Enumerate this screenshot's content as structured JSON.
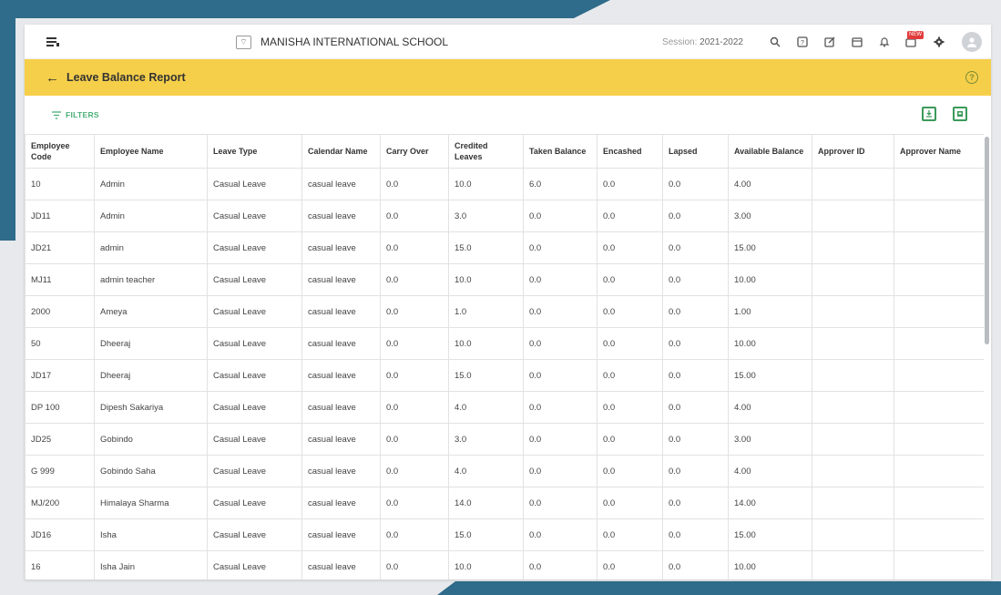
{
  "header": {
    "school_name": "MANISHA INTERNATIONAL SCHOOL",
    "session_label": "Session:",
    "session_value": "2021-2022",
    "badge": "NEW"
  },
  "page": {
    "title": "Leave Balance Report",
    "filters_label": "FILTERS"
  },
  "table": {
    "columns": [
      "Employee Code",
      "Employee Name",
      "Leave Type",
      "Calendar Name",
      "Carry Over",
      "Credited Leaves",
      "Taken Balance",
      "Encashed",
      "Lapsed",
      "Available Balance",
      "Approver ID",
      "Approver Name"
    ],
    "rows": [
      [
        "10",
        "Admin",
        "Casual Leave",
        "casual leave",
        "0.0",
        "10.0",
        "6.0",
        "0.0",
        "0.0",
        "4.00",
        "",
        ""
      ],
      [
        "JD11",
        "Admin",
        "Casual Leave",
        "casual leave",
        "0.0",
        "3.0",
        "0.0",
        "0.0",
        "0.0",
        "3.00",
        "",
        ""
      ],
      [
        "JD21",
        "admin",
        "Casual Leave",
        "casual leave",
        "0.0",
        "15.0",
        "0.0",
        "0.0",
        "0.0",
        "15.00",
        "",
        ""
      ],
      [
        "MJ11",
        "admin teacher",
        "Casual Leave",
        "casual leave",
        "0.0",
        "10.0",
        "0.0",
        "0.0",
        "0.0",
        "10.00",
        "",
        ""
      ],
      [
        "2000",
        "Ameya",
        "Casual Leave",
        "casual leave",
        "0.0",
        "1.0",
        "0.0",
        "0.0",
        "0.0",
        "1.00",
        "",
        ""
      ],
      [
        "50",
        "Dheeraj",
        "Casual Leave",
        "casual leave",
        "0.0",
        "10.0",
        "0.0",
        "0.0",
        "0.0",
        "10.00",
        "",
        ""
      ],
      [
        "JD17",
        "Dheeraj",
        "Casual Leave",
        "casual leave",
        "0.0",
        "15.0",
        "0.0",
        "0.0",
        "0.0",
        "15.00",
        "",
        ""
      ],
      [
        "DP 100",
        "Dipesh Sakariya",
        "Casual Leave",
        "casual leave",
        "0.0",
        "4.0",
        "0.0",
        "0.0",
        "0.0",
        "4.00",
        "",
        ""
      ],
      [
        "JD25",
        "Gobindo",
        "Casual Leave",
        "casual leave",
        "0.0",
        "3.0",
        "0.0",
        "0.0",
        "0.0",
        "3.00",
        "",
        ""
      ],
      [
        "G 999",
        "Gobindo Saha",
        "Casual Leave",
        "casual leave",
        "0.0",
        "4.0",
        "0.0",
        "0.0",
        "0.0",
        "4.00",
        "",
        ""
      ],
      [
        "MJ/200",
        "Himalaya Sharma",
        "Casual Leave",
        "casual leave",
        "0.0",
        "14.0",
        "0.0",
        "0.0",
        "0.0",
        "14.00",
        "",
        ""
      ],
      [
        "JD16",
        "Isha",
        "Casual Leave",
        "casual leave",
        "0.0",
        "15.0",
        "0.0",
        "0.0",
        "0.0",
        "15.00",
        "",
        ""
      ],
      [
        "16",
        "Isha Jain",
        "Casual Leave",
        "casual leave",
        "0.0",
        "10.0",
        "0.0",
        "0.0",
        "0.0",
        "10.00",
        "",
        ""
      ]
    ]
  }
}
